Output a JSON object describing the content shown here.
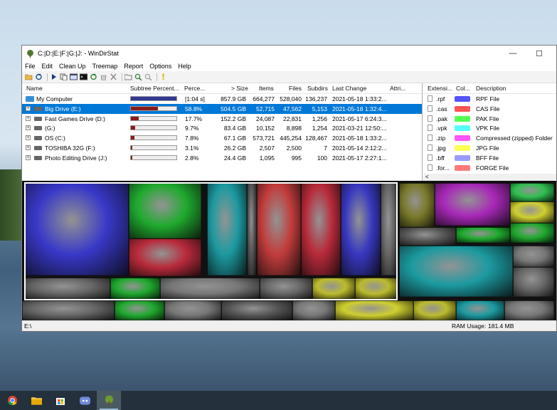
{
  "window": {
    "title": "C:|D:|E:|F:|G:|J: - WinDirStat",
    "controls": {
      "minimize": "—",
      "maximize": "☐"
    }
  },
  "menu": [
    "File",
    "Edit",
    "Clean Up",
    "Treemap",
    "Report",
    "Options",
    "Help"
  ],
  "toolbar_icons": [
    "open-folder-icon",
    "refresh-icon",
    "play-icon",
    "copy-icon",
    "explorer-icon",
    "cmd-icon",
    "refresh-green-icon",
    "recycle-icon",
    "delete-icon",
    "properties-icon",
    "zoom-in-icon",
    "zoom-out-icon",
    "help-icon"
  ],
  "tree": {
    "headers": {
      "name": "Name",
      "subtree": "Subtree Percent...",
      "percent": "Perce...",
      "size": "> Size",
      "items": "Items",
      "files": "Files",
      "subdirs": "Subdirs",
      "last_change": "Last Change",
      "attributes": "Attri..."
    },
    "rows": [
      {
        "name": "My Computer",
        "percent": "[1:04 s]",
        "size": "857.9 GB",
        "items": "664,277",
        "files": "528,040",
        "subdirs": "136,237",
        "last_change": "2021-05-18  1:33:2...",
        "fraction": 1.0,
        "bar_color": "#303890",
        "expander": ""
      },
      {
        "name": "Big Drive (E:)",
        "percent": "58.8%",
        "size": "504.5 GB",
        "items": "52,715",
        "files": "47,562",
        "subdirs": "5,153",
        "last_change": "2021-05-18  1:32:4...",
        "fraction": 0.588,
        "bar_color": "#8a1c1c",
        "expander": "+"
      },
      {
        "name": "Fast Games Drive (D:)",
        "percent": "17.7%",
        "size": "152.2 GB",
        "items": "24,087",
        "files": "22,831",
        "subdirs": "1,256",
        "last_change": "2021-05-17  6:24:3...",
        "fraction": 0.177,
        "bar_color": "#8a1c1c",
        "expander": "+"
      },
      {
        "name": "(G:)",
        "percent": "9.7%",
        "size": "83.4 GB",
        "items": "10,152",
        "files": "8,898",
        "subdirs": "1,254",
        "last_change": "2021-03-21  12:50:...",
        "fraction": 0.097,
        "bar_color": "#8a1c1c",
        "expander": "+"
      },
      {
        "name": "OS (C:)",
        "percent": "7.8%",
        "size": "67.1 GB",
        "items": "573,721",
        "files": "445,254",
        "subdirs": "128,467",
        "last_change": "2021-05-18  1:33:2...",
        "fraction": 0.078,
        "bar_color": "#8a1c1c",
        "expander": "+"
      },
      {
        "name": "TOSHIBA 32G (F:)",
        "percent": "3.1%",
        "size": "26.2 GB",
        "items": "2,507",
        "files": "2,500",
        "subdirs": "7",
        "last_change": "2021-05-14  2:12:2...",
        "fraction": 0.031,
        "bar_color": "#8a1c1c",
        "expander": "+"
      },
      {
        "name": "Photo Editing Drive (J:)",
        "percent": "2.8%",
        "size": "24.4 GB",
        "items": "1,095",
        "files": "995",
        "subdirs": "100",
        "last_change": "2021-05-17  2:27:1...",
        "fraction": 0.028,
        "bar_color": "#8a1c1c",
        "expander": "+"
      }
    ]
  },
  "extensions": {
    "headers": {
      "ext": "Extensi...",
      "color": "Col...",
      "description": "Description"
    },
    "rows": [
      {
        "ext": ".rpf",
        "color": "#5454ff",
        "description": "RPF File"
      },
      {
        "ext": ".cas",
        "color": "#ff5454",
        "description": "CAS File"
      },
      {
        "ext": ".pak",
        "color": "#54ff54",
        "description": "PAK File"
      },
      {
        "ext": ".vpk",
        "color": "#54ffff",
        "description": "VPK File"
      },
      {
        "ext": ".zip",
        "color": "#ff54ff",
        "description": "Compressed (zipped) Folder"
      },
      {
        "ext": ".jpg",
        "color": "#ffff54",
        "description": "JPG File"
      },
      {
        "ext": ".bff",
        "color": "#9a9aff",
        "description": "BFF File"
      },
      {
        "ext": ".for...",
        "color": "#ff7a7a",
        "description": "FORGE File"
      }
    ],
    "scroll_left": "<"
  },
  "status": {
    "path": "E:\\",
    "ram_label": "RAM Usage:",
    "ram_value": "181.4 MB"
  },
  "taskbar_icons": [
    "chrome-icon",
    "file-explorer-icon",
    "store-icon",
    "discord-icon",
    "windirstat-icon"
  ]
}
